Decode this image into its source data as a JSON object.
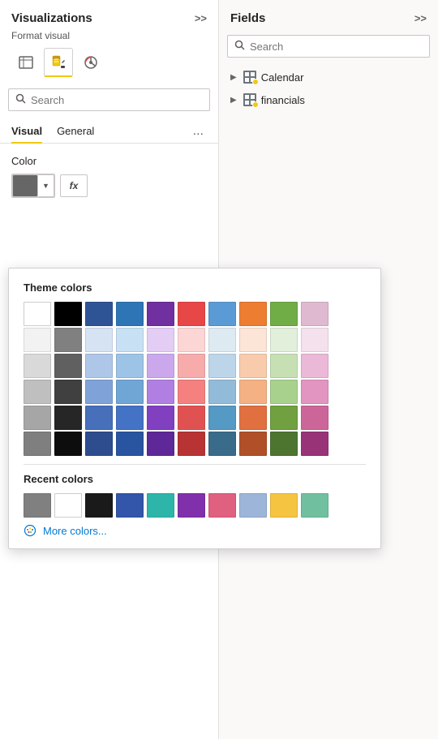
{
  "leftPanel": {
    "title": "Visualizations",
    "expandLabel": ">>",
    "formatVisualLabel": "Format visual",
    "icons": [
      {
        "name": "table-icon",
        "active": false
      },
      {
        "name": "paint-icon",
        "active": true
      },
      {
        "name": "analytics-icon",
        "active": false
      }
    ],
    "searchPlaceholder": "Search",
    "tabs": [
      {
        "id": "visual",
        "label": "Visual",
        "active": true
      },
      {
        "id": "general",
        "label": "General",
        "active": false
      }
    ],
    "tabMoreLabel": "...",
    "colorLabel": "Color",
    "fxLabel": "fx",
    "colorPickerDropdown": {
      "themeColorsTitle": "Theme colors",
      "themeColors": [
        [
          "#ffffff",
          "#000000",
          "#2F5496",
          "#2E75B6",
          "#7030A0",
          "#E84747",
          "#5B9BD5",
          "#ED7D31",
          "#70AD47",
          "#DEB9D0"
        ],
        [
          "#f2f2f2",
          "#808080",
          "#d6e3f3",
          "#c7e0f4",
          "#e3cdf5",
          "#fcd5d5",
          "#deeaf1",
          "#fce4d6",
          "#e2efda",
          "#f5e1ed"
        ],
        [
          "#d9d9d9",
          "#606060",
          "#aec7e8",
          "#9dc3e6",
          "#cba7eb",
          "#f8abab",
          "#bcd5e9",
          "#f8cbad",
          "#c6e0b4",
          "#ebb8d8"
        ],
        [
          "#bfbfbf",
          "#404040",
          "#7fa3d9",
          "#6fa6d6",
          "#b07fe1",
          "#f48080",
          "#92bbd9",
          "#f4b183",
          "#a9d18e",
          "#e195c0"
        ],
        [
          "#a6a6a6",
          "#262626",
          "#476fba",
          "#4472C4",
          "#8040c0",
          "#e05252",
          "#5599c5",
          "#e07040",
          "#70a040",
          "#cc6699"
        ],
        [
          "#7f7f7f",
          "#0d0d0d",
          "#2e4d8f",
          "#2955a0",
          "#5e2898",
          "#b83333",
          "#3a6b8a",
          "#b05028",
          "#4d7530",
          "#993377"
        ]
      ],
      "recentColorsTitle": "Recent colors",
      "recentColors": [
        "#808080",
        "#ffffff",
        "#1a1a1a",
        "#3355aa",
        "#2db5aa",
        "#8030aa",
        "#e06080",
        "#9cb5d8",
        "#f5c542",
        "#70c0a0"
      ],
      "moreColorsLabel": "More colors..."
    }
  },
  "rightPanel": {
    "title": "Fields",
    "expandLabel": ">>",
    "searchPlaceholder": "Search",
    "fields": [
      {
        "id": "calendar",
        "name": "Calendar",
        "hasBadge": true
      },
      {
        "id": "financials",
        "name": "financials",
        "hasBadge": true
      }
    ]
  }
}
